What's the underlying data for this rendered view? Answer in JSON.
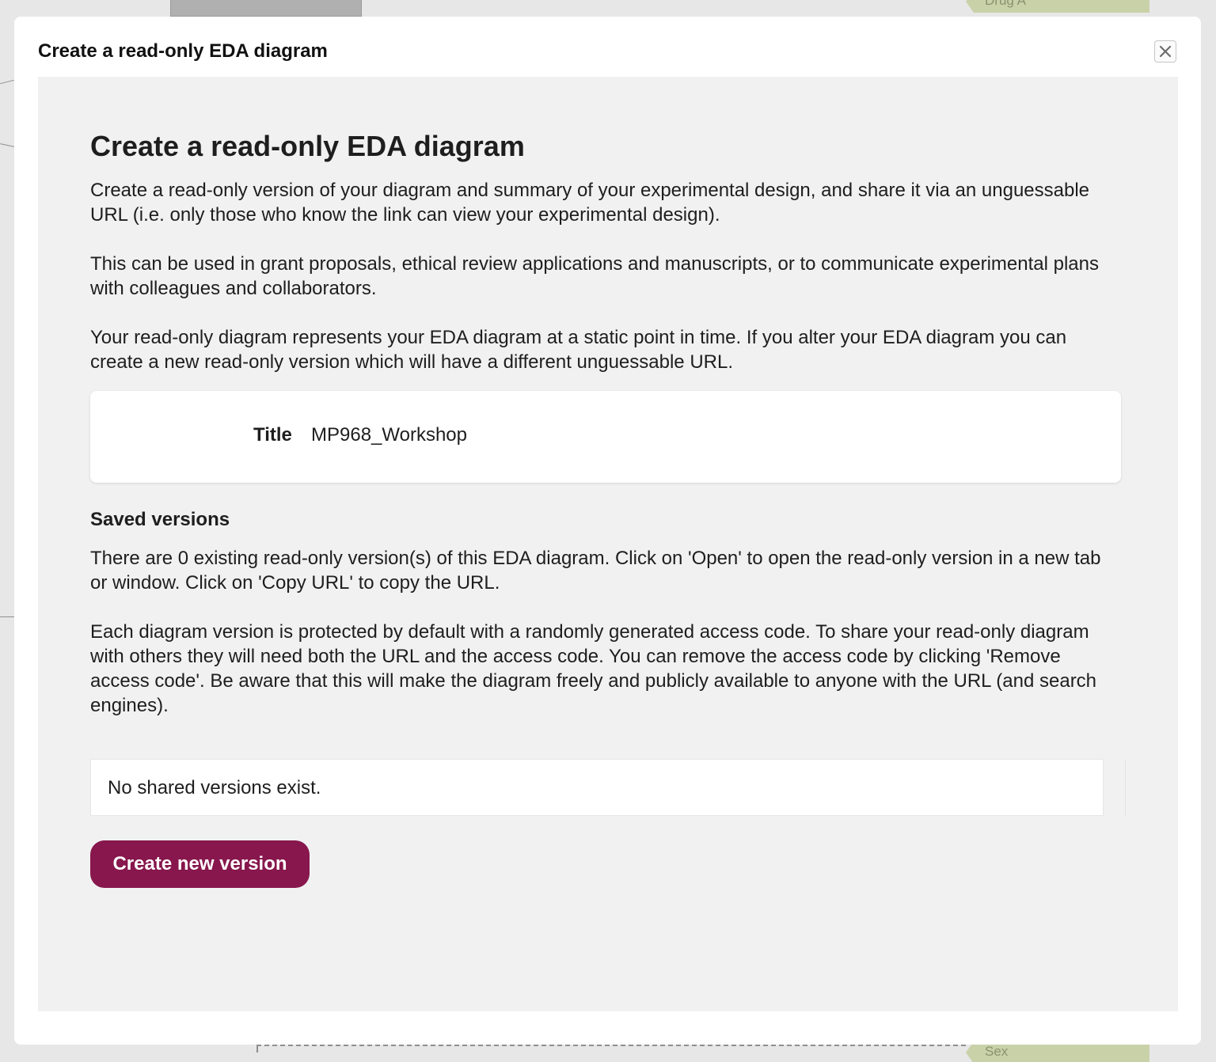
{
  "background": {
    "top_node_label": "Drug A",
    "bottom_node_label": "Sex"
  },
  "modal": {
    "window_title": "Create a read-only EDA diagram",
    "close_icon": "close-icon",
    "heading": "Create a read-only EDA diagram",
    "paragraphs": [
      "Create a read-only version of your diagram and summary of your experimental design, and share it via an unguessable URL (i.e. only those who know the link can view your experimental design).",
      "This can be used in grant proposals, ethical review applications and manuscripts, or to communicate experimental plans with colleagues and collaborators.",
      "Your read-only diagram represents your EDA diagram at a static point in time. If you alter your EDA diagram you can create a new read-only version which will have a different unguessable URL."
    ],
    "title_field": {
      "label": "Title",
      "value": "MP968_Workshop"
    },
    "saved_versions": {
      "heading": "Saved versions",
      "paragraphs": [
        "There are 0 existing read-only version(s) of this EDA diagram. Click on 'Open' to open the read-only version in a new tab or window. Click on 'Copy URL' to copy the URL.",
        "Each diagram version is protected by default with a randomly generated access code. To share your read-only diagram with others they will need both the URL and the access code. You can remove the access code by clicking 'Remove access code'. Be aware that this will make the diagram freely and publicly available to anyone with the URL (and search engines)."
      ],
      "empty_message": "No shared versions exist."
    },
    "create_button_label": "Create new version"
  },
  "colors": {
    "accent": "#87174d",
    "panel_background": "#f1f1f1",
    "card_background": "#ffffff"
  }
}
